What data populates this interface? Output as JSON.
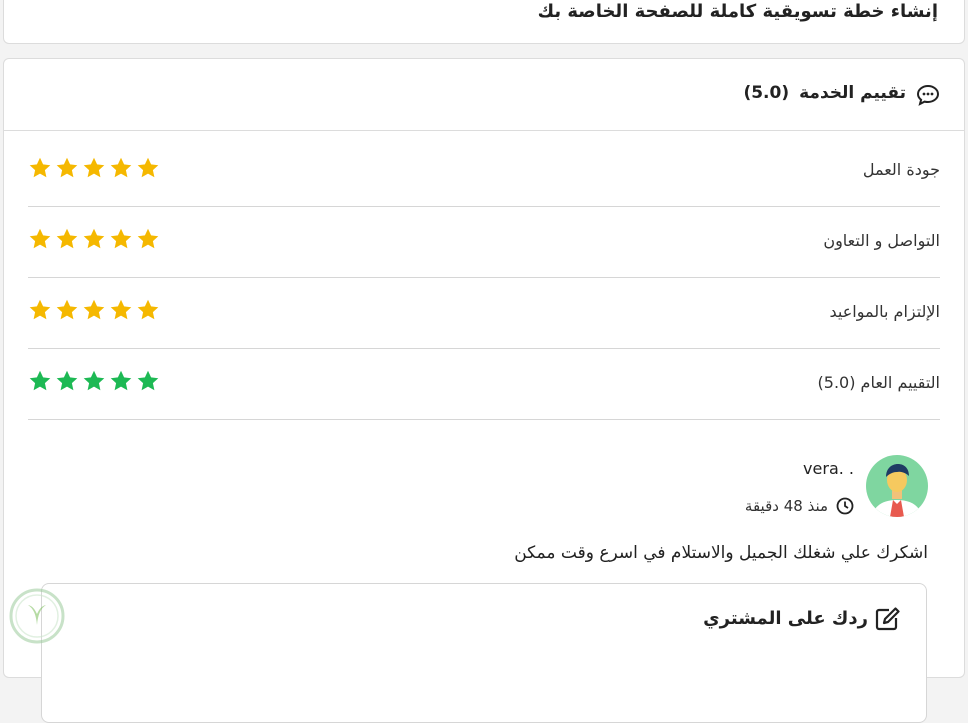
{
  "service": {
    "title": "إنشاء خطة تسويقية كاملة للصفحة الخاصة بك"
  },
  "rating_section": {
    "title": "تقييم الخدمة",
    "score": "(5.0)",
    "icon": "chat-bubble-icon",
    "rows": [
      {
        "label": "جودة العمل",
        "stars": 5,
        "star_color": "#f5b800"
      },
      {
        "label": "التواصل و التعاون",
        "stars": 5,
        "star_color": "#f5b800"
      },
      {
        "label": "الإلتزام بالمواعيد",
        "stars": 5,
        "star_color": "#f5b800"
      },
      {
        "label": "التقييم العام (5.0)",
        "stars": 5,
        "star_color": "#1db954"
      }
    ]
  },
  "review": {
    "reviewer": "vera. .",
    "time_ago": "منذ 48 دقيقة",
    "comment": "اشكرك علي شغلك الجميل والاستلام في اسرع وقت ممكن",
    "avatar": "user-avatar"
  },
  "reply": {
    "label": "ردك على المشتري",
    "icon": "edit-icon"
  }
}
